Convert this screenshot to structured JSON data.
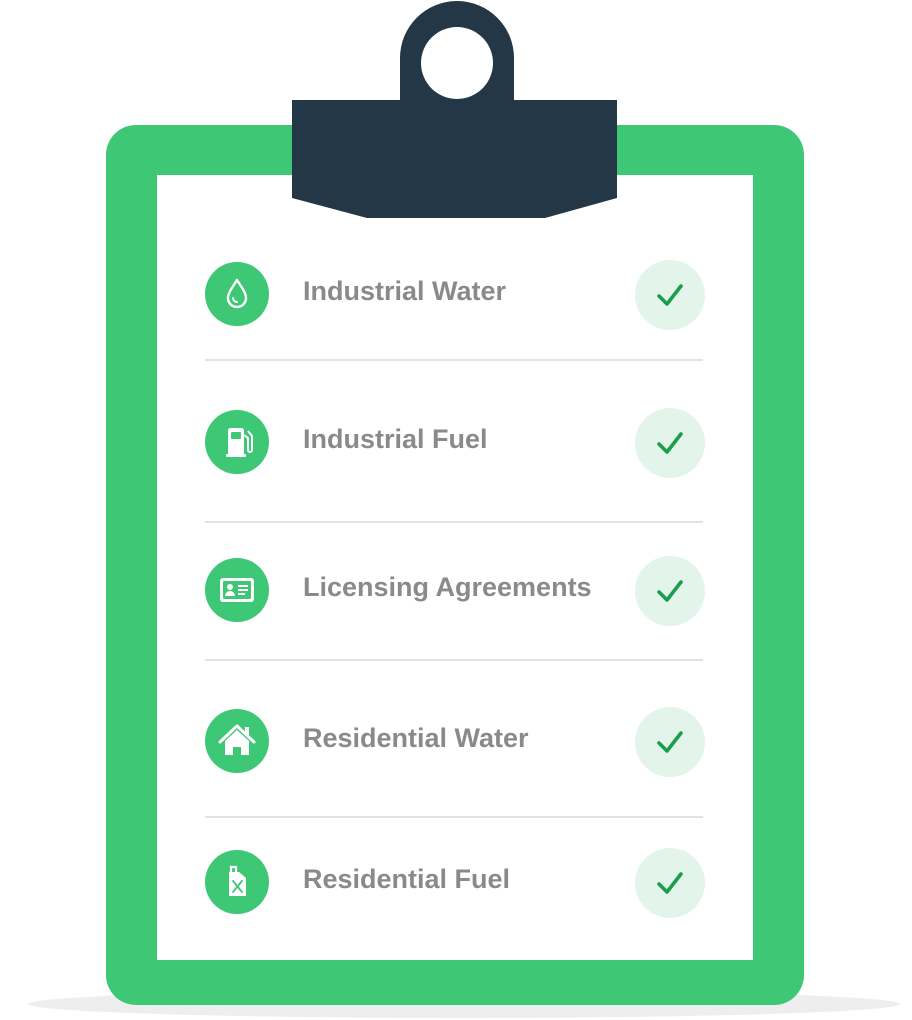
{
  "checklist": {
    "items": [
      {
        "label": "Industrial Water",
        "icon": "water-drop-icon",
        "checked": true
      },
      {
        "label": "Industrial Fuel",
        "icon": "fuel-pump-icon",
        "checked": true
      },
      {
        "label": "Licensing Agreements",
        "icon": "id-card-icon",
        "checked": true
      },
      {
        "label": "Residential Water",
        "icon": "house-icon",
        "checked": true
      },
      {
        "label": "Residential Fuel",
        "icon": "jerrycan-icon",
        "checked": true
      }
    ]
  },
  "colors": {
    "board": "#3ec775",
    "clip": "#243746",
    "text": "#8a8a8a",
    "check_bg": "#e3f5ea",
    "check_mark": "#1b9e4b"
  }
}
